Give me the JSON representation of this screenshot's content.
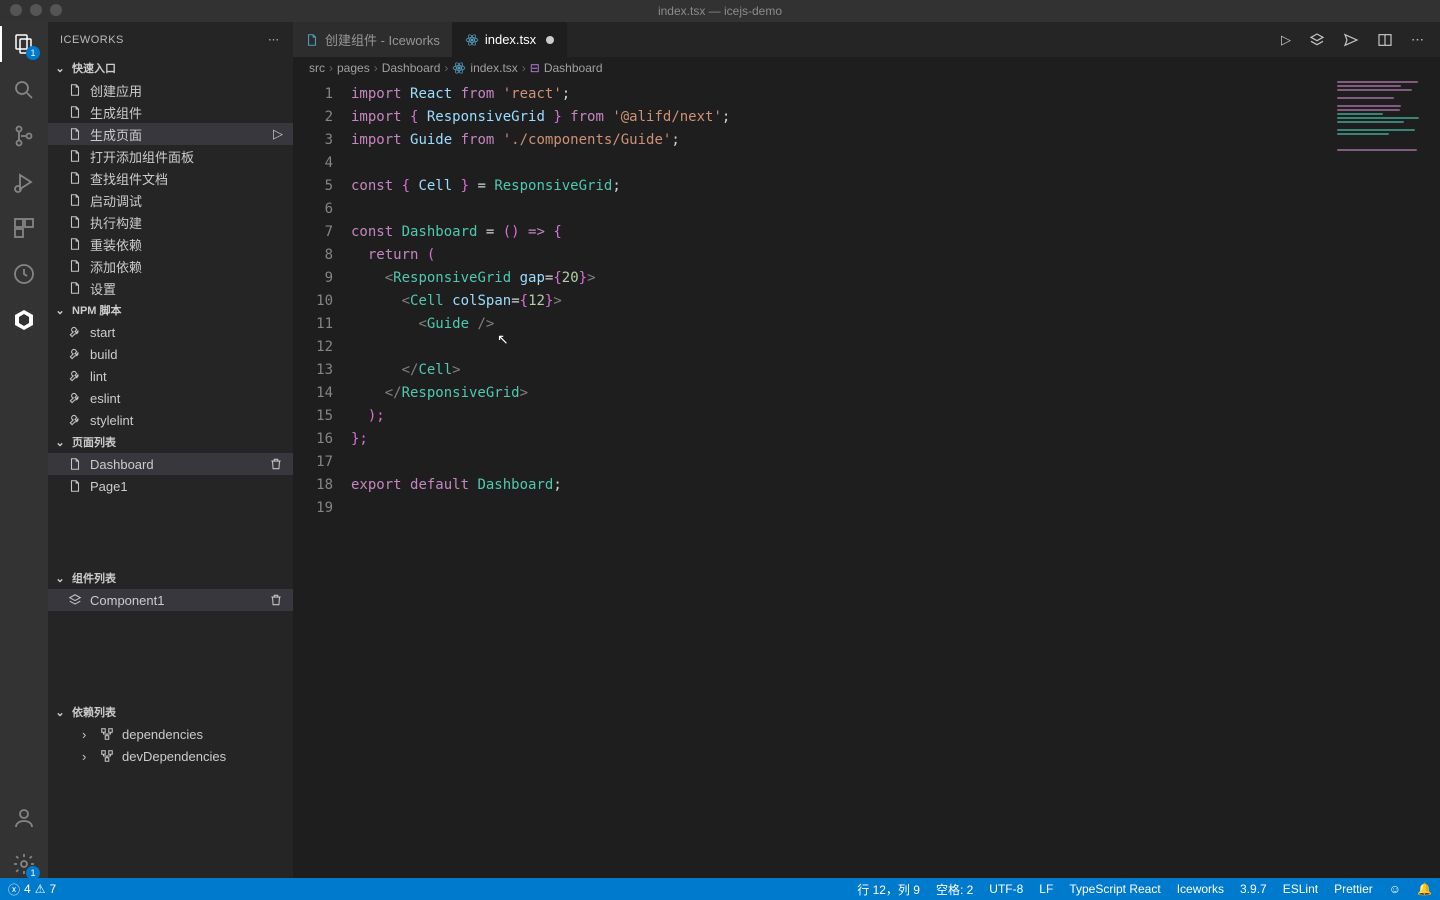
{
  "window": {
    "title": "index.tsx — icejs-demo"
  },
  "activitybar": {
    "explorer_badge": "1",
    "settings_badge": "1"
  },
  "sidebar": {
    "title": "ICEWORKS",
    "sections": {
      "quickstart": {
        "label": "快速入口",
        "items": [
          {
            "icon": "file",
            "label": "创建应用"
          },
          {
            "icon": "file",
            "label": "生成组件"
          },
          {
            "icon": "file",
            "label": "生成页面",
            "selected": true,
            "action": "play"
          },
          {
            "icon": "file",
            "label": "打开添加组件面板"
          },
          {
            "icon": "file",
            "label": "查找组件文档"
          },
          {
            "icon": "file",
            "label": "启动调试"
          },
          {
            "icon": "file",
            "label": "执行构建"
          },
          {
            "icon": "file",
            "label": "重装依赖"
          },
          {
            "icon": "file",
            "label": "添加依赖"
          },
          {
            "icon": "file",
            "label": "设置"
          }
        ]
      },
      "npm": {
        "label": "NPM 脚本",
        "items": [
          {
            "icon": "wrench",
            "label": "start"
          },
          {
            "icon": "wrench",
            "label": "build"
          },
          {
            "icon": "wrench",
            "label": "lint"
          },
          {
            "icon": "wrench",
            "label": "eslint"
          },
          {
            "icon": "wrench",
            "label": "stylelint"
          }
        ]
      },
      "pages": {
        "label": "页面列表",
        "items": [
          {
            "icon": "file",
            "label": "Dashboard",
            "selected": true,
            "trash": true
          },
          {
            "icon": "file",
            "label": "Page1"
          }
        ]
      },
      "components": {
        "label": "组件列表",
        "items": [
          {
            "icon": "layers",
            "label": "Component1",
            "selected": true,
            "trash": true
          }
        ]
      },
      "deps": {
        "label": "依赖列表",
        "items": [
          {
            "icon": "tree",
            "label": "dependencies",
            "caret": true
          },
          {
            "icon": "tree",
            "label": "devDependencies",
            "caret": true
          }
        ]
      }
    }
  },
  "tabs": [
    {
      "label": "创建组件 - Iceworks",
      "active": false,
      "icon": "file-blue"
    },
    {
      "label": "index.tsx",
      "active": true,
      "dirty": true,
      "icon": "react"
    }
  ],
  "breadcrumbs": [
    {
      "label": "src"
    },
    {
      "label": "pages"
    },
    {
      "label": "Dashboard"
    },
    {
      "label": "index.tsx",
      "icon": "react"
    },
    {
      "label": "Dashboard",
      "icon": "symbol"
    }
  ],
  "code": {
    "lines": 19,
    "tokens": [
      [
        [
          "import ",
          "kw"
        ],
        [
          "React",
          "var"
        ],
        [
          " from ",
          "kw"
        ],
        [
          "'react'",
          "str"
        ],
        [
          ";",
          "punct"
        ]
      ],
      [
        [
          "import ",
          "kw"
        ],
        [
          "{ ",
          "brace"
        ],
        [
          "ResponsiveGrid",
          "var"
        ],
        [
          " }",
          "brace"
        ],
        [
          " from ",
          "kw"
        ],
        [
          "'@alifd/next'",
          "str"
        ],
        [
          ";",
          "punct"
        ]
      ],
      [
        [
          "import ",
          "kw"
        ],
        [
          "Guide",
          "var"
        ],
        [
          " from ",
          "kw"
        ],
        [
          "'./components/Guide'",
          "str"
        ],
        [
          ";",
          "punct"
        ]
      ],
      [],
      [
        [
          "const ",
          "kw"
        ],
        [
          "{ ",
          "brace"
        ],
        [
          "Cell",
          "var"
        ],
        [
          " }",
          "brace"
        ],
        [
          " = ",
          "punct"
        ],
        [
          "ResponsiveGrid",
          "type"
        ],
        [
          ";",
          "punct"
        ]
      ],
      [],
      [
        [
          "const ",
          "kw"
        ],
        [
          "Dashboard",
          "type"
        ],
        [
          " = ",
          "punct"
        ],
        [
          "() ",
          "brace"
        ],
        [
          "=>",
          "kw"
        ],
        [
          " {",
          "brace"
        ]
      ],
      [
        [
          "  ",
          ""
        ],
        [
          "return ",
          "kw"
        ],
        [
          "(",
          "brace"
        ]
      ],
      [
        [
          "    ",
          ""
        ],
        [
          "<",
          "tag"
        ],
        [
          "ResponsiveGrid",
          "type"
        ],
        [
          " ",
          ""
        ],
        [
          "gap",
          "attr"
        ],
        [
          "=",
          "punct"
        ],
        [
          "{",
          "brace"
        ],
        [
          "20",
          "num"
        ],
        [
          "}",
          "brace"
        ],
        [
          ">",
          "tag"
        ]
      ],
      [
        [
          "      ",
          ""
        ],
        [
          "<",
          "tag"
        ],
        [
          "Cell",
          "type"
        ],
        [
          " ",
          ""
        ],
        [
          "colSpan",
          "attr"
        ],
        [
          "=",
          "punct"
        ],
        [
          "{",
          "brace"
        ],
        [
          "12",
          "num"
        ],
        [
          "}",
          "brace"
        ],
        [
          ">",
          "tag"
        ]
      ],
      [
        [
          "        ",
          ""
        ],
        [
          "<",
          "tag"
        ],
        [
          "Guide",
          "type"
        ],
        [
          " />",
          "tag"
        ]
      ],
      [],
      [
        [
          "      ",
          ""
        ],
        [
          "</",
          "tag"
        ],
        [
          "Cell",
          "type"
        ],
        [
          ">",
          "tag"
        ]
      ],
      [
        [
          "    ",
          ""
        ],
        [
          "</",
          "tag"
        ],
        [
          "ResponsiveGrid",
          "type"
        ],
        [
          ">",
          "tag"
        ]
      ],
      [
        [
          "  ",
          ""
        ],
        [
          ");",
          "brace"
        ]
      ],
      [
        [
          "};",
          "brace"
        ]
      ],
      [],
      [
        [
          "export ",
          "kw"
        ],
        [
          "default ",
          "kw"
        ],
        [
          "Dashboard",
          "type"
        ],
        [
          ";",
          "punct"
        ]
      ],
      []
    ]
  },
  "statusbar": {
    "errors": "4",
    "warnings": "7",
    "line_col": "行 12，列 9",
    "spaces": "空格: 2",
    "encoding": "UTF-8",
    "eol": "LF",
    "language": "TypeScript React",
    "ext_iceworks": "Iceworks",
    "ext_version": "3.9.7",
    "eslint": "ESLint",
    "prettier": "Prettier"
  }
}
